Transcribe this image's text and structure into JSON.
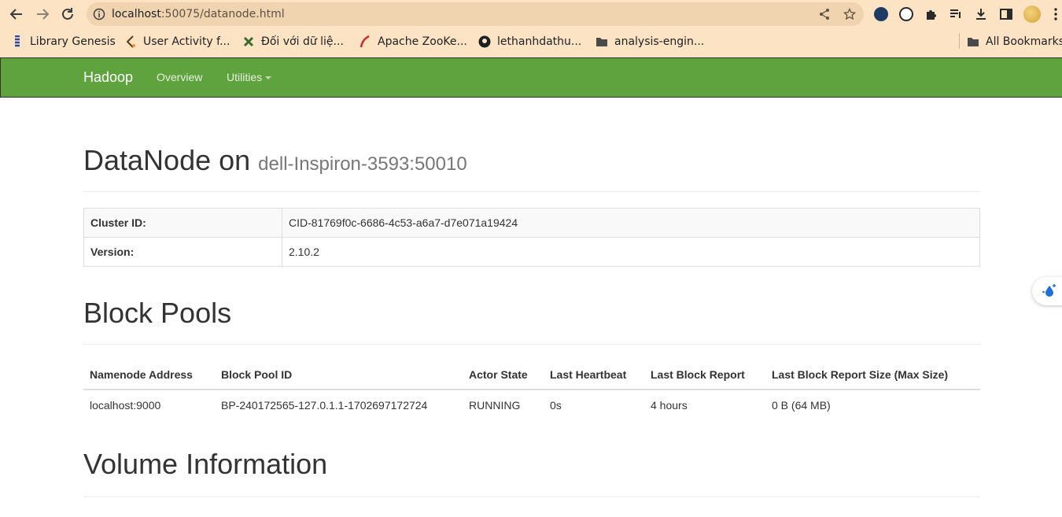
{
  "browser": {
    "url_host": "localhost",
    "url_path": ":50075/datanode.html",
    "bookmarks": [
      {
        "label": "Library Genesis",
        "icon": "libgen-icon"
      },
      {
        "label": "User Activity f...",
        "icon": "activity-icon"
      },
      {
        "label": "Đối với dữ liệ...",
        "icon": "puzzle-icon"
      },
      {
        "label": "Apache ZooKe...",
        "icon": "feather-icon"
      },
      {
        "label": "lethanhdathu...",
        "icon": "github-icon"
      },
      {
        "label": "analysis-engin...",
        "icon": "folder-icon"
      }
    ],
    "all_bookmarks_label": "All Bookmarks"
  },
  "navbar": {
    "brand": "Hadoop",
    "links": [
      "Overview",
      "Utilities"
    ],
    "brand_color": "#5fa33e"
  },
  "header": {
    "title": "DataNode on",
    "host": "dell-Inspiron-3593:50010"
  },
  "info": {
    "rows": [
      {
        "key": "Cluster ID:",
        "value": "CID-81769f0c-6686-4c53-a6a7-d7e071a19424"
      },
      {
        "key": "Version:",
        "value": "2.10.2"
      }
    ]
  },
  "block_pools": {
    "title": "Block Pools",
    "columns": [
      "Namenode Address",
      "Block Pool ID",
      "Actor State",
      "Last Heartbeat",
      "Last Block Report",
      "Last Block Report Size (Max Size)"
    ],
    "rows": [
      [
        "localhost:9000",
        "BP-240172565-127.0.1.1-1702697172724",
        "RUNNING",
        "0s",
        "4 hours",
        "0 B (64 MB)"
      ]
    ]
  },
  "volume": {
    "title": "Volume Information"
  }
}
